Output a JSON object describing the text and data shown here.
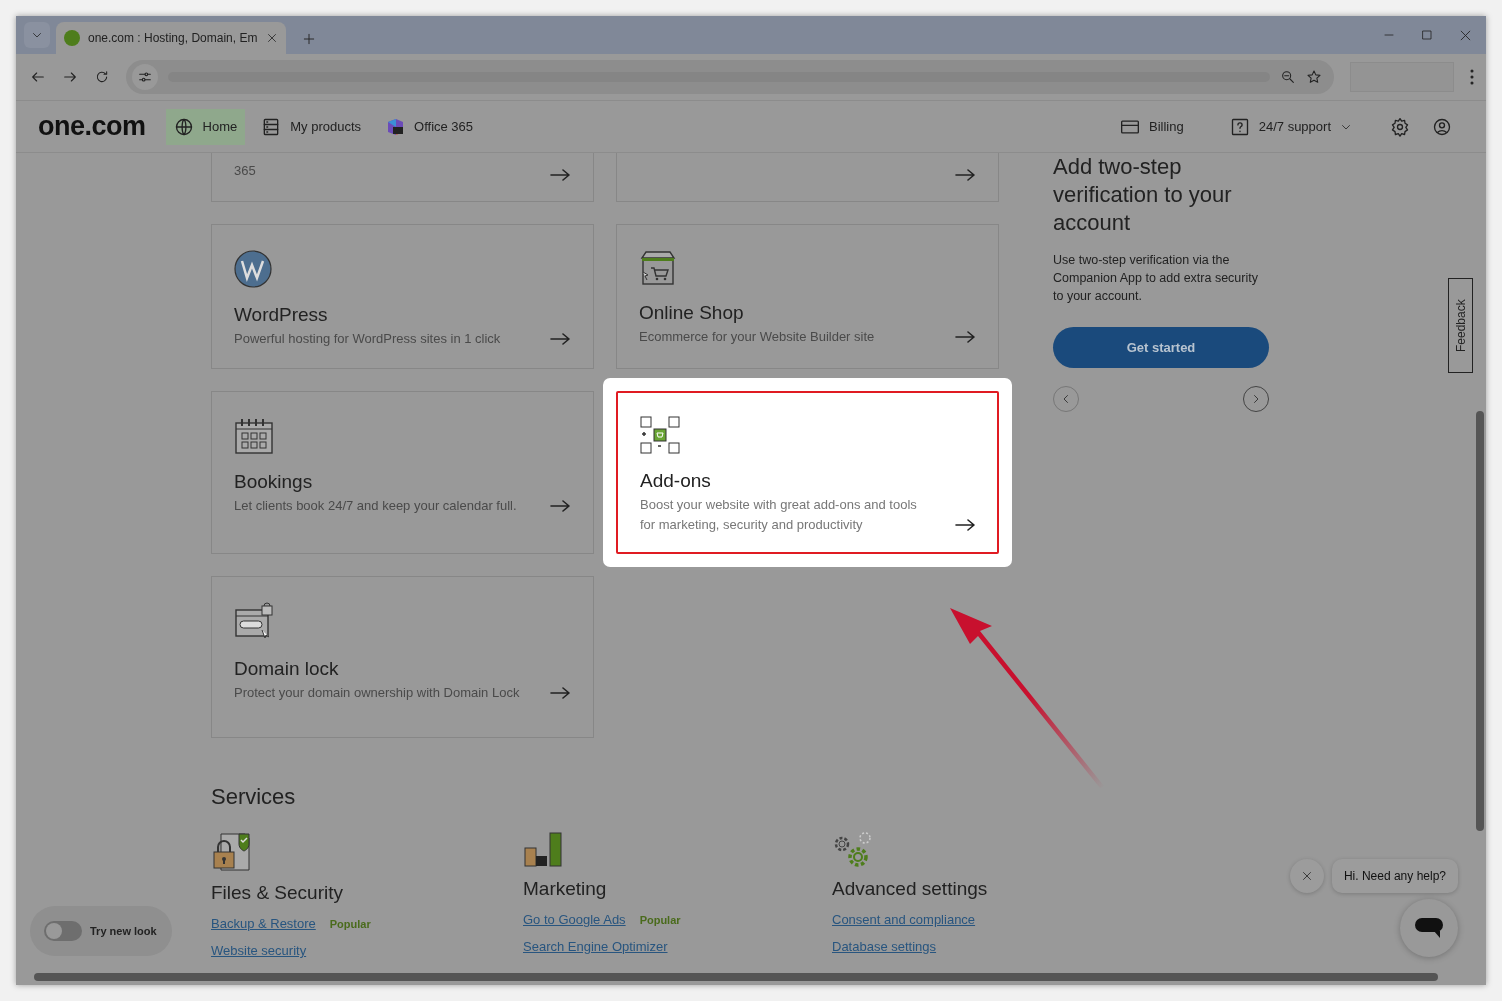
{
  "browser": {
    "tabs": [
      {
        "title": "one.com : Hosting, Domain, Em",
        "selected": true
      }
    ]
  },
  "site_nav": {
    "logo": "one.com",
    "items": [
      {
        "label": "Home",
        "kind": "globe",
        "selected": true
      },
      {
        "label": "My products",
        "kind": "list",
        "selected": false
      },
      {
        "label": "Office 365",
        "kind": "office",
        "selected": false
      }
    ],
    "right_items": [
      {
        "label": "Billing",
        "kind": "card"
      },
      {
        "label": "24/7 support",
        "kind": "help"
      }
    ]
  },
  "products": [
    {
      "kind": "none",
      "description": "365",
      "highlighted": false
    },
    {
      "kind": "none",
      "highlighted": false
    },
    {
      "kind": "wordpress",
      "title": "WordPress",
      "description": "Powerful hosting for WordPress sites in 1 click",
      "highlighted": false
    },
    {
      "kind": "shop",
      "title": "Online Shop",
      "description": "Ecommerce for your Website Builder site",
      "highlighted": false
    },
    {
      "kind": "calendar",
      "title": "Bookings",
      "description": "Let clients book 24/7 and keep your calendar full.",
      "highlighted": false
    },
    {
      "kind": "addons",
      "title": "Add-ons",
      "description": "Boost your website with great add-ons and tools for marketing, security and productivity",
      "highlighted": true
    },
    {
      "kind": "domain",
      "title": "Domain lock",
      "description": "Protect your domain ownership with Domain Lock",
      "highlighted": false
    }
  ],
  "promo": {
    "title": "Add two-step verification to your account",
    "text": "Use two-step verification via the Companion App to add extra security to your account.",
    "button": "Get started"
  },
  "feedback": "Feedback",
  "services": {
    "title": "Services",
    "groups": [
      {
        "kind": "security",
        "title": "Files & Security",
        "links": [
          {
            "label": "Backup & Restore",
            "badge": "Popular"
          },
          {
            "label": "Website security"
          }
        ]
      },
      {
        "kind": "marketing",
        "title": "Marketing",
        "links": [
          {
            "label": "Go to Google Ads",
            "badge": "Popular"
          },
          {
            "label": "Search Engine Optimizer"
          }
        ]
      },
      {
        "kind": "settings",
        "title": "Advanced settings",
        "links": [
          {
            "label": "Consent and compliance"
          },
          {
            "label": "Database settings"
          }
        ]
      }
    ]
  },
  "new_look": {
    "label": "Try new look",
    "on": false
  },
  "chat": {
    "message": "Hi. Need any help?"
  }
}
